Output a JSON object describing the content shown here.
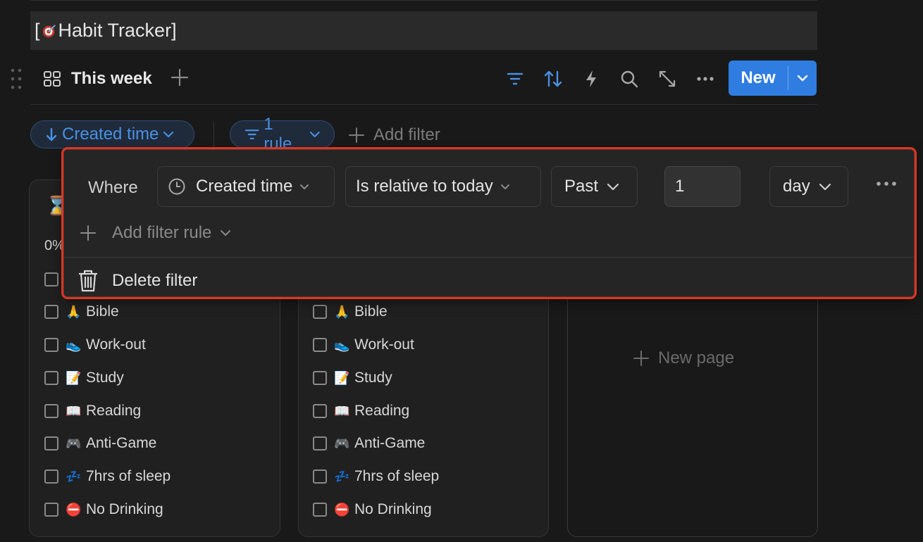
{
  "page": {
    "title_prefix": "[",
    "title_text": "Habit Tracker]",
    "title_icon": "target-icon"
  },
  "toolbar": {
    "view_label": "This week",
    "view_icon": "gallery-grid-icon",
    "new_label": "New",
    "accent": "#2f7de1"
  },
  "filter_bar": {
    "sort_label": "Created time",
    "rule_label": "1 rule",
    "add_filter_label": "Add filter"
  },
  "filter_popup": {
    "where_label": "Where",
    "property": "Created time",
    "condition": "Is relative to today",
    "direction": "Past",
    "amount": "1",
    "unit": "day",
    "add_rule_label": "Add filter rule",
    "delete_label": "Delete filter",
    "highlight_color": "#e2331f"
  },
  "cards": [
    {
      "header_icon": "⌛",
      "progress": "0%",
      "items": [
        {
          "emoji": "🙏",
          "label": "Bible"
        },
        {
          "emoji": "👟",
          "label": "Work-out"
        },
        {
          "emoji": "📝",
          "label": "Study"
        },
        {
          "emoji": "📖",
          "label": "Reading"
        },
        {
          "emoji": "🎮",
          "label": "Anti-Game"
        },
        {
          "emoji": "💤",
          "label": "7hrs of sleep"
        },
        {
          "emoji": "⛔",
          "label": "No Drinking"
        }
      ]
    },
    {
      "items": [
        {
          "emoji": "🙏",
          "label": "Bible"
        },
        {
          "emoji": "👟",
          "label": "Work-out"
        },
        {
          "emoji": "📝",
          "label": "Study"
        },
        {
          "emoji": "📖",
          "label": "Reading"
        },
        {
          "emoji": "🎮",
          "label": "Anti-Game"
        },
        {
          "emoji": "💤",
          "label": "7hrs of sleep"
        },
        {
          "emoji": "⛔",
          "label": "No Drinking"
        }
      ]
    }
  ],
  "new_page_label": "New page"
}
